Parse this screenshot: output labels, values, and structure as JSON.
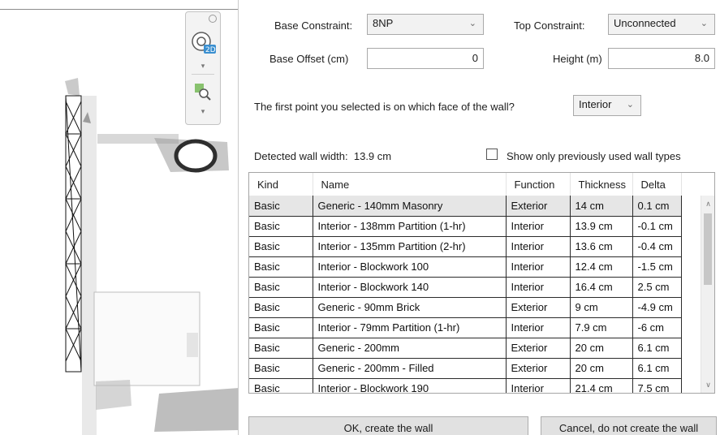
{
  "form": {
    "base_constraint_label": "Base Constraint:",
    "base_constraint_value": "8NP",
    "top_constraint_label": "Top Constraint:",
    "top_constraint_value": "Unconnected",
    "base_offset_label": "Base Offset (cm)",
    "base_offset_value": "0",
    "height_label": "Height (m)",
    "height_value": "8.0",
    "face_question": "The first point you selected is on which face of the wall?",
    "face_value": "Interior",
    "detected_label": "Detected wall width:",
    "detected_value": "13.9 cm",
    "show_previous_label": "Show only previously used wall types"
  },
  "table": {
    "columns": [
      "Kind",
      "Name",
      "Function",
      "Thickness",
      "Delta"
    ],
    "rows": [
      [
        "Basic",
        "Generic - 140mm Masonry",
        "Exterior",
        "14 cm",
        "0.1 cm"
      ],
      [
        "Basic",
        "Interior - 138mm Partition (1-hr)",
        "Interior",
        "13.9 cm",
        "-0.1 cm"
      ],
      [
        "Basic",
        "Interior - 135mm Partition (2-hr)",
        "Interior",
        "13.6 cm",
        "-0.4 cm"
      ],
      [
        "Basic",
        "Interior - Blockwork 100",
        "Interior",
        "12.4 cm",
        "-1.5 cm"
      ],
      [
        "Basic",
        "Interior - Blockwork 140",
        "Interior",
        "16.4 cm",
        "2.5 cm"
      ],
      [
        "Basic",
        "Generic - 90mm Brick",
        "Exterior",
        "9 cm",
        "-4.9 cm"
      ],
      [
        "Basic",
        "Interior - 79mm Partition (1-hr)",
        "Interior",
        "7.9 cm",
        "-6 cm"
      ],
      [
        "Basic",
        "Generic - 200mm",
        "Exterior",
        "20 cm",
        "6.1 cm"
      ],
      [
        "Basic",
        "Generic - 200mm - Filled",
        "Exterior",
        "20 cm",
        "6.1 cm"
      ],
      [
        "Basic",
        "Interior - Blockwork 190",
        "Interior",
        "21.4 cm",
        "7.5 cm"
      ]
    ]
  },
  "buttons": {
    "ok": "OK, create the wall",
    "cancel": "Cancel, do not create the wall"
  },
  "navbar": {
    "icons": [
      "steering-wheel-2d-icon",
      "zoom-region-icon"
    ]
  }
}
